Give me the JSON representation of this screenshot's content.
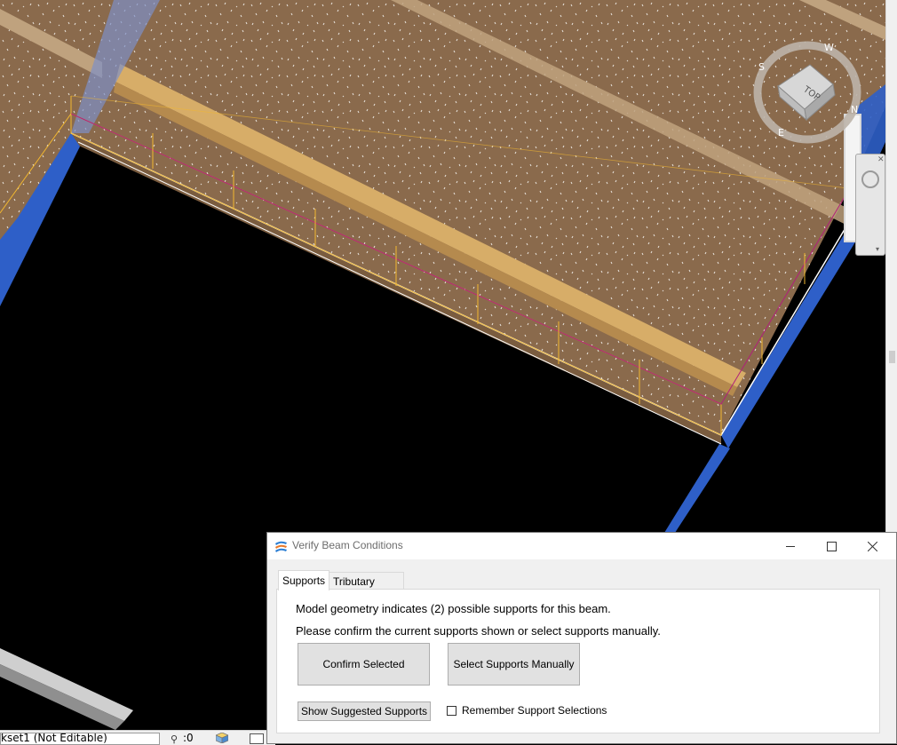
{
  "dialog": {
    "title": "Verify Beam Conditions",
    "tabs": [
      {
        "label": "Supports",
        "active": true
      },
      {
        "label": "Tributary Beams",
        "active": false
      }
    ],
    "message_line1": "Model geometry indicates (2) possible supports for this beam.",
    "message_line2": "Please confirm the current supports shown or select supports manually.",
    "confirm_label": "Confirm Selected",
    "manual_label": "Select Supports Manually",
    "suggested_label": "Show Suggested Supports",
    "remember_label": "Remember Support Selections",
    "remember_checked": false
  },
  "viewcube": {
    "face_label": "TOP",
    "compass": [
      "S",
      "W",
      "N",
      "E"
    ]
  },
  "statusbar": {
    "workset": "kset1 (Not Editable)",
    "selection_count": ":0"
  },
  "colors": {
    "deck": "#8c6b4a",
    "beam_yellow": "#d4a860",
    "steel_blue": "#2e5fc8",
    "load_line": "#f2b830",
    "background": "#000000"
  }
}
